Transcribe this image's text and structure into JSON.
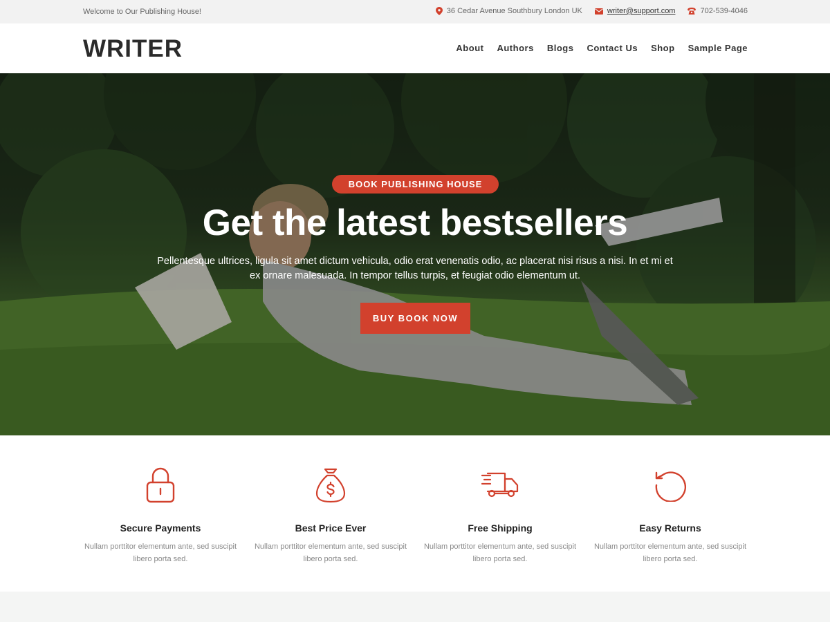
{
  "topbar": {
    "welcome": "Welcome to Our Publishing House!",
    "address": "36 Cedar Avenue Southbury London UK",
    "email": "writer@support.com",
    "phone": "702-539-4046"
  },
  "header": {
    "logo": "WRITER",
    "nav": [
      "About",
      "Authors",
      "Blogs",
      "Contact Us",
      "Shop",
      "Sample Page"
    ]
  },
  "hero": {
    "badge": "BOOK PUBLISHING HOUSE",
    "title": "Get the latest bestsellers",
    "text": "Pellentesque ultrices, ligula sit amet dictum vehicula, odio erat venenatis odio, ac placerat nisi risus a nisi. In et mi et ex ornare malesuada. In tempor tellus turpis, et feugiat odio elementum ut.",
    "cta": "BUY BOOK NOW"
  },
  "features": [
    {
      "icon": "lock-icon",
      "title": "Secure Payments",
      "text": "Nullam porttitor elementum ante, sed suscipit libero porta sed."
    },
    {
      "icon": "money-bag-icon",
      "title": "Best Price Ever",
      "text": "Nullam porttitor elementum ante, sed suscipit libero porta sed."
    },
    {
      "icon": "truck-icon",
      "title": "Free Shipping",
      "text": "Nullam porttitor elementum ante, sed suscipit libero porta sed."
    },
    {
      "icon": "return-icon",
      "title": "Easy Returns",
      "text": "Nullam porttitor elementum ante, sed suscipit libero porta sed."
    }
  ],
  "colors": {
    "accent": "#d2412d",
    "text": "#222222",
    "muted": "#888888"
  }
}
